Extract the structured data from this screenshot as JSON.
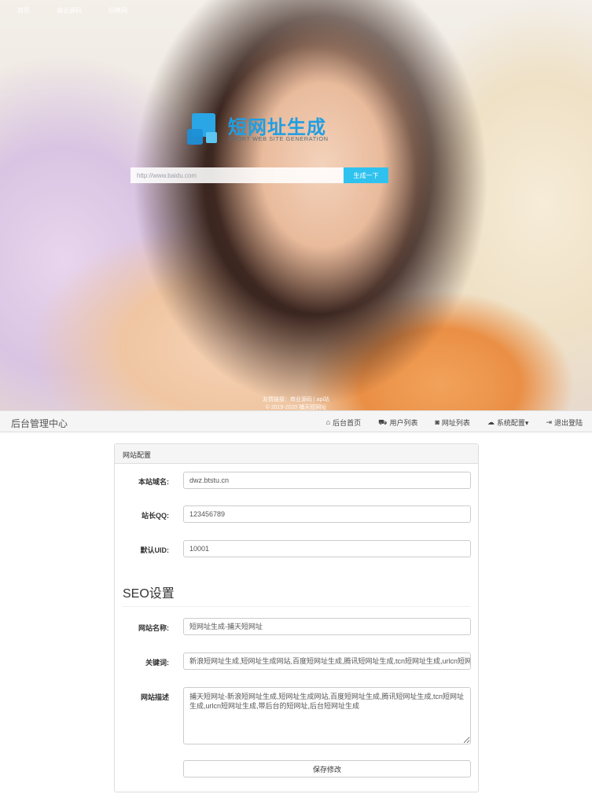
{
  "hero": {
    "nav": [
      "首页",
      "商业源码",
      "招聘网"
    ],
    "logo_title": "短网址生成",
    "logo_subtitle": "SHORT WEB SITE GENERATION",
    "search_placeholder": "http://www.baidu.com",
    "generate_label": "生成一下",
    "friend_links": "友情链接：商业源码 | api站",
    "copyright": "© 2019-2020 捕天短网址"
  },
  "navbar": {
    "brand": "后台管理中心",
    "items": [
      {
        "icon": "⌂",
        "label": "后台首页"
      },
      {
        "icon": "⛟",
        "label": "用户列表"
      },
      {
        "icon": "◙",
        "label": "网址列表"
      },
      {
        "icon": "☁",
        "label": "系统配置▾"
      },
      {
        "icon": "⇥",
        "label": "退出登陆"
      }
    ]
  },
  "panel": {
    "heading": "网站配置",
    "domain_label": "本站域名:",
    "domain_value": "dwz.btstu.cn",
    "qq_label": "站长QQ:",
    "qq_value": "123456789",
    "uid_label": "默认UID:",
    "uid_value": "10001",
    "seo_heading": "SEO设置",
    "sitename_label": "网站名称:",
    "sitename_value": "短网址生成-捕天短网址",
    "keywords_label": "关键词:",
    "keywords_value": "新浪短网址生成,短网址生成网站,百度短网址生成,腾讯短网址生成,tcn短网址生成,urlcn短网址生成",
    "desc_label": "网站描述",
    "desc_value": "捕天短网址-新浪短网址生成,短网址生成网站,百度短网址生成,腾讯短网址生成,tcn短网址生成,urlcn短网址生成,带后台的短网址,后台短网址生成",
    "save_label": "保存修改"
  }
}
